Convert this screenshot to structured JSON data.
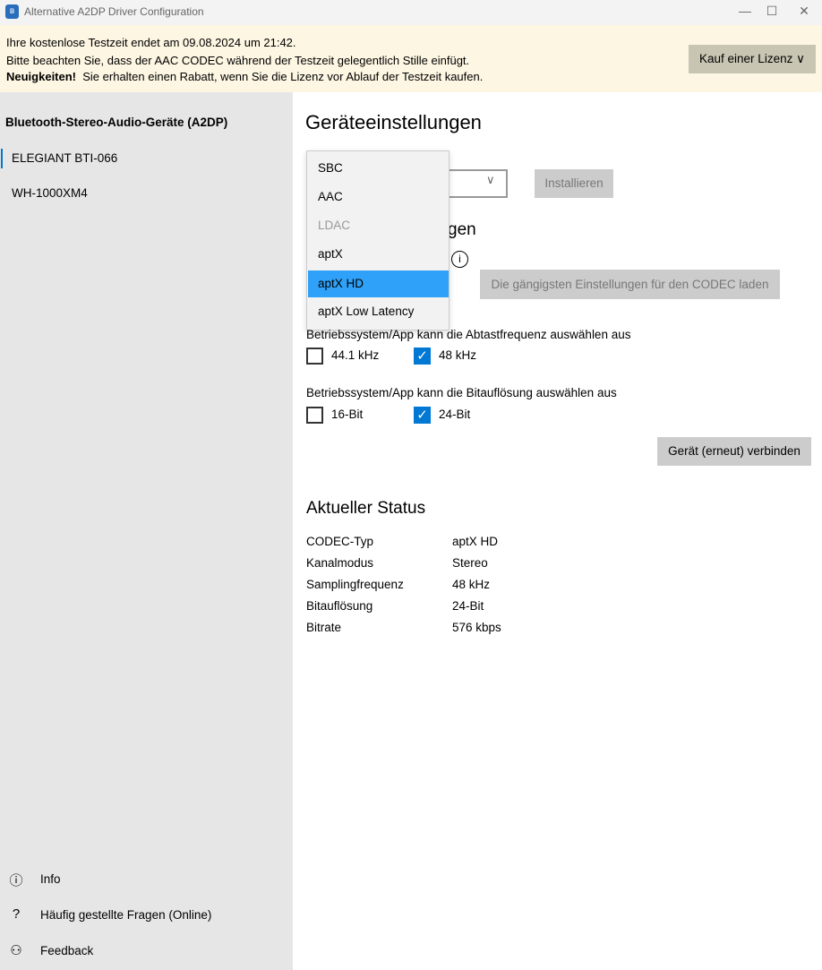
{
  "window": {
    "title": "Alternative A2DP Driver Configuration",
    "minimize": "—",
    "maximize": "☐",
    "close": "✕",
    "icon": "bluetooth-icon"
  },
  "banner": {
    "line1": "Ihre kostenlose Testzeit endet am 09.08.2024 um 21:42.",
    "line2": "Bitte beachten Sie, dass der AAC CODEC während der Testzeit gelegentlich Stille einfügt.",
    "news_bold": "Neuigkeiten!",
    "news_text": "Sie erhalten einen Rabatt, wenn Sie die Lizenz vor Ablauf der Testzeit kaufen.",
    "buy_button": "Kauf einer Lizenz ∨"
  },
  "sidebar": {
    "header": "Bluetooth-Stereo-Audio-Geräte (A2DP)",
    "devices": [
      {
        "label": "ELEGIANT BTI-066",
        "selected": true
      },
      {
        "label": "WH-1000XM4",
        "selected": false
      }
    ],
    "footer": [
      {
        "icon": "info-icon",
        "glyph": "ⓘ",
        "label": "Info"
      },
      {
        "icon": "question-icon",
        "glyph": "?",
        "label": "Häufig gestellte Fragen (Online)"
      },
      {
        "icon": "feedback-icon",
        "glyph": "⚇",
        "label": "Feedback"
      }
    ]
  },
  "main": {
    "title": "Geräteeinstellungen",
    "install_button": "Installieren",
    "section_fragment": "gen",
    "info_glyph": "i",
    "load_button": "Die gängigsten Einstellungen für den CODEC laden",
    "codec_dropdown": {
      "options": [
        {
          "label": "SBC",
          "disabled": false
        },
        {
          "label": "AAC",
          "disabled": false
        },
        {
          "label": "LDAC",
          "disabled": true
        },
        {
          "label": "aptX",
          "disabled": false
        },
        {
          "label": "aptX HD",
          "disabled": false,
          "selected": true
        },
        {
          "label": "aptX Low Latency",
          "disabled": false
        }
      ]
    },
    "sample_rate": {
      "label": "Betriebssystem/App kann die Abtastfrequenz auswählen aus",
      "options": [
        {
          "label": "44.1 kHz",
          "checked": false
        },
        {
          "label": "48 kHz",
          "checked": true
        }
      ]
    },
    "bit_depth": {
      "label": "Betriebssystem/App kann die Bitauflösung auswählen aus",
      "options": [
        {
          "label": "16-Bit",
          "checked": false
        },
        {
          "label": "24-Bit",
          "checked": true
        }
      ]
    },
    "connect_button": "Gerät (erneut) verbinden",
    "status": {
      "title": "Aktueller Status",
      "rows": [
        {
          "key": "CODEC-Typ",
          "value": "aptX HD"
        },
        {
          "key": "Kanalmodus",
          "value": "Stereo"
        },
        {
          "key": "Samplingfrequenz",
          "value": "48 kHz"
        },
        {
          "key": "Bitauflösung",
          "value": "24-Bit"
        },
        {
          "key": "Bitrate",
          "value": "576 kbps"
        }
      ]
    }
  },
  "colors": {
    "accent": "#0078d4",
    "dropdown_selected": "#2fa1f8",
    "banner": "#fdf6e3"
  }
}
